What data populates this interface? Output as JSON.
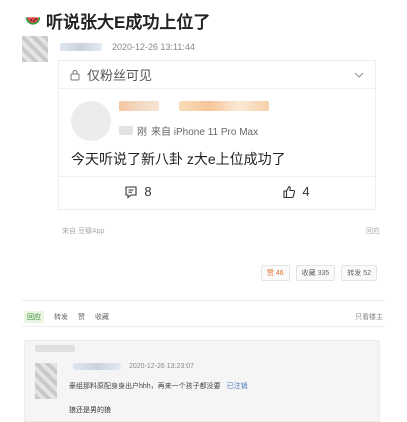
{
  "thread": {
    "title": "听说张大E成功上位了"
  },
  "op": {
    "timestamp": "2020-12-26 13:11:44"
  },
  "card": {
    "visibility": "仅粉丝可见",
    "device": "来自 iPhone 11 Pro Max",
    "device_prefix": "刚",
    "text": "今天听说了新八卦 z大e上位成功了",
    "comments": "8",
    "likes": "4"
  },
  "footer": {
    "source": "来自 豆瓣App",
    "report": "回应",
    "likes": "赞 46",
    "collect": "收藏 335",
    "share": "转发 52"
  },
  "reply_bar": {
    "reply": "回应",
    "repost": "转发",
    "like": "赞",
    "collect": "收藏",
    "only_op": "只看楼主"
  },
  "reply": {
    "timestamp": "2020-12-26 13:23:07",
    "quote": "豪组那料原配身身出户hhh，再来一个孩子都没要",
    "quote_link": "已注销",
    "text": "狼还是男的狼"
  },
  "colors": {
    "accent_green": "#3a8a3a",
    "hot_orange": "#e0702a",
    "link_blue": "#4a7ab5"
  },
  "icons": [
    "watermelon-icon",
    "lock-icon",
    "chevron-down-icon",
    "comment-icon",
    "thumbs-up-icon"
  ]
}
